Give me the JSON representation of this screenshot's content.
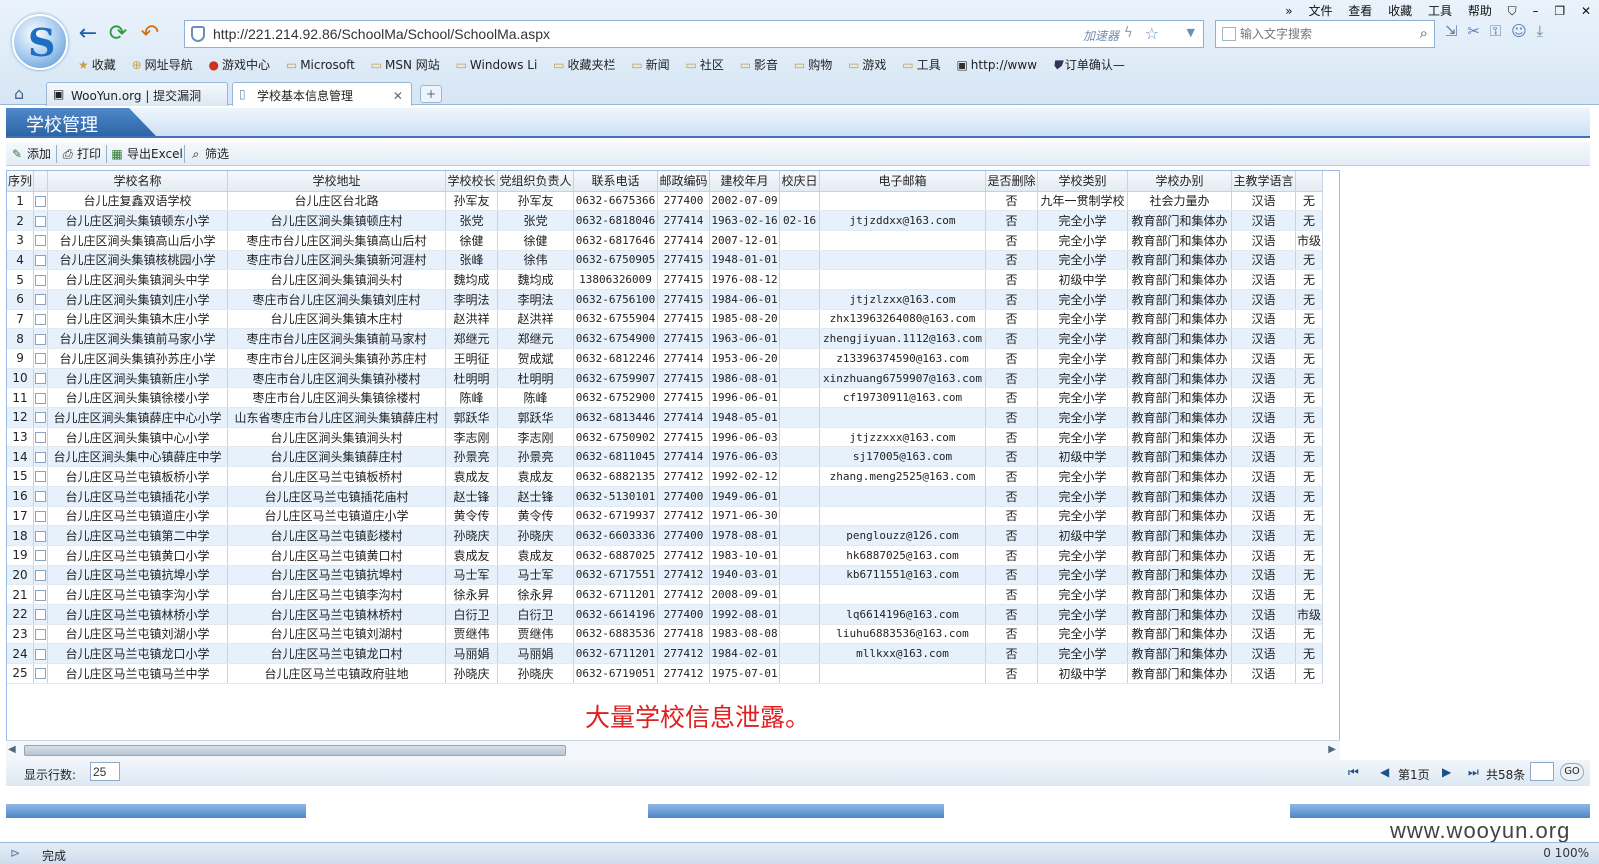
{
  "browser": {
    "menu": [
      "文件",
      "查看",
      "收藏",
      "工具",
      "帮助"
    ],
    "url": "http://221.214.92.86/SchoolMa/School/SchoolMa.aspx",
    "accelerator": "加速器",
    "search_placeholder": "输入文字搜索",
    "favorites": [
      "收藏",
      "网址导航",
      "游戏中心",
      "Microsoft",
      "MSN 网站",
      "Windows Li",
      "收藏夹栏",
      "新闻",
      "社区",
      "影音",
      "购物",
      "游戏",
      "工具",
      "http://www",
      "订单确认—"
    ],
    "tabs": [
      {
        "label": "WooYun.org | 提交漏洞"
      },
      {
        "label": "学校基本信息管理"
      }
    ],
    "status_text": "完成",
    "status_right": "0    100%"
  },
  "page": {
    "title": "学校管理",
    "toolbar": {
      "add": "添加",
      "print": "打印",
      "export": "导出Excel",
      "filter": "筛选"
    },
    "columns": [
      "序列",
      "",
      "学校名称",
      "学校地址",
      "学校校长",
      "党组织负责人",
      "联系电话",
      "邮政编码",
      "建校年月",
      "校庆日",
      "电子邮箱",
      "是否删除",
      "学校类别",
      "学校办别",
      "主教学语言",
      ""
    ],
    "rows": [
      [
        "1",
        "台儿庄复鑫双语学校",
        "台儿庄区台北路",
        "孙军友",
        "孙军友",
        "0632-6675366",
        "277400",
        "2002-07-09",
        "",
        "",
        "否",
        "九年一贯制学校",
        "社会力量办",
        "汉语",
        "无"
      ],
      [
        "2",
        "台儿庄区涧头集镇顿东小学",
        "台儿庄区涧头集镇顿庄村",
        "张党",
        "张党",
        "0632-6818046",
        "277414",
        "1963-02-16",
        "02-16",
        "jtjzddxx@163.com",
        "否",
        "完全小学",
        "教育部门和集体办",
        "汉语",
        "无"
      ],
      [
        "3",
        "台儿庄区涧头集镇高山后小学",
        "枣庄市台儿庄区涧头集镇高山后村",
        "徐健",
        "徐健",
        "0632-6817646",
        "277414",
        "2007-12-01",
        "",
        "",
        "否",
        "完全小学",
        "教育部门和集体办",
        "汉语",
        "市级"
      ],
      [
        "4",
        "台儿庄区涧头集镇核桃园小学",
        "枣庄市台儿庄区涧头集镇新河涯村",
        "张峰",
        "徐伟",
        "0632-6750905",
        "277415",
        "1948-01-01",
        "",
        "",
        "否",
        "完全小学",
        "教育部门和集体办",
        "汉语",
        "无"
      ],
      [
        "5",
        "台儿庄区涧头集镇涧头中学",
        "台儿庄区涧头集镇涧头村",
        "魏均成",
        "魏均成",
        "13806326009",
        "277415",
        "1976-08-12",
        "",
        "",
        "否",
        "初级中学",
        "教育部门和集体办",
        "汉语",
        "无"
      ],
      [
        "6",
        "台儿庄区涧头集镇刘庄小学",
        "枣庄市台儿庄区涧头集镇刘庄村",
        "李明法",
        "李明法",
        "0632-6756100",
        "277415",
        "1984-06-01",
        "",
        "jtjzlzxx@163.com",
        "否",
        "完全小学",
        "教育部门和集体办",
        "汉语",
        "无"
      ],
      [
        "7",
        "台儿庄区涧头集镇木庄小学",
        "台儿庄区涧头集镇木庄村",
        "赵洪祥",
        "赵洪祥",
        "0632-6755904",
        "277415",
        "1985-08-20",
        "",
        "zhx13963264080@163.com",
        "否",
        "完全小学",
        "教育部门和集体办",
        "汉语",
        "无"
      ],
      [
        "8",
        "台儿庄区涧头集镇前马家小学",
        "枣庄市台儿庄区涧头集镇前马家村",
        "郑继元",
        "郑继元",
        "0632-6754900",
        "277415",
        "1963-06-01",
        "",
        "zhengjiyuan.1112@163.com",
        "否",
        "完全小学",
        "教育部门和集体办",
        "汉语",
        "无"
      ],
      [
        "9",
        "台儿庄区涧头集镇孙苏庄小学",
        "枣庄市台儿庄区涧头集镇孙苏庄村",
        "王明征",
        "贺成斌",
        "0632-6812246",
        "277414",
        "1953-06-20",
        "",
        "z13396374590@163.com",
        "否",
        "完全小学",
        "教育部门和集体办",
        "汉语",
        "无"
      ],
      [
        "10",
        "台儿庄区涧头集镇新庄小学",
        "枣庄市台儿庄区涧头集镇孙楼村",
        "杜明明",
        "杜明明",
        "0632-6759907",
        "277415",
        "1986-08-01",
        "",
        "xinzhuang6759907@163.com",
        "否",
        "完全小学",
        "教育部门和集体办",
        "汉语",
        "无"
      ],
      [
        "11",
        "台儿庄区涧头集镇徐楼小学",
        "枣庄市台儿庄区涧头集镇徐楼村",
        "陈峰",
        "陈峰",
        "0632-6752900",
        "277415",
        "1996-06-01",
        "",
        "cf19730911@163.com",
        "否",
        "完全小学",
        "教育部门和集体办",
        "汉语",
        "无"
      ],
      [
        "12",
        "台儿庄区涧头集镇薛庄中心小学",
        "山东省枣庄市台儿庄区涧头集镇薛庄村",
        "郭跃华",
        "郭跃华",
        "0632-6813446",
        "277414",
        "1948-05-01",
        "",
        "",
        "否",
        "完全小学",
        "教育部门和集体办",
        "汉语",
        "无"
      ],
      [
        "13",
        "台儿庄区涧头集镇中心小学",
        "台儿庄区涧头集镇涧头村",
        "李志刚",
        "李志刚",
        "0632-6750902",
        "277415",
        "1996-06-03",
        "",
        "jtjzzxxx@163.com",
        "否",
        "完全小学",
        "教育部门和集体办",
        "汉语",
        "无"
      ],
      [
        "14",
        "台儿庄区涧头集中心镇薛庄中学",
        "台儿庄区涧头集镇薛庄村",
        "孙景亮",
        "孙景亮",
        "0632-6811045",
        "277414",
        "1976-06-03",
        "",
        "sj17005@163.com",
        "否",
        "初级中学",
        "教育部门和集体办",
        "汉语",
        "无"
      ],
      [
        "15",
        "台儿庄区马兰屯镇板桥小学",
        "台儿庄区马兰屯镇板桥村",
        "袁成友",
        "袁成友",
        "0632-6882135",
        "277412",
        "1992-02-12",
        "",
        "zhang.meng2525@163.com",
        "否",
        "完全小学",
        "教育部门和集体办",
        "汉语",
        "无"
      ],
      [
        "16",
        "台儿庄区马兰屯镇插花小学",
        "台儿庄区马兰屯镇插花庙村",
        "赵士锋",
        "赵士锋",
        "0632-5130101",
        "277400",
        "1949-06-01",
        "",
        "",
        "否",
        "完全小学",
        "教育部门和集体办",
        "汉语",
        "无"
      ],
      [
        "17",
        "台儿庄区马兰屯镇道庄小学",
        "台儿庄区马兰屯镇道庄小学",
        "黄令传",
        "黄令传",
        "0632-6719937",
        "277412",
        "1971-06-30",
        "",
        "",
        "否",
        "完全小学",
        "教育部门和集体办",
        "汉语",
        "无"
      ],
      [
        "18",
        "台儿庄区马兰屯镇第二中学",
        "台儿庄区马兰屯镇彭楼村",
        "孙晓庆",
        "孙晓庆",
        "0632-6603336",
        "277400",
        "1978-08-01",
        "",
        "penglouzz@126.com",
        "否",
        "初级中学",
        "教育部门和集体办",
        "汉语",
        "无"
      ],
      [
        "19",
        "台儿庄区马兰屯镇黄口小学",
        "台儿庄区马兰屯镇黄口村",
        "袁成友",
        "袁成友",
        "0632-6887025",
        "277412",
        "1983-10-01",
        "",
        "hk6887025@163.com",
        "否",
        "完全小学",
        "教育部门和集体办",
        "汉语",
        "无"
      ],
      [
        "20",
        "台儿庄区马兰屯镇抗埠小学",
        "台儿庄区马兰屯镇抗埠村",
        "马士军",
        "马士军",
        "0632-6717551",
        "277412",
        "1940-03-01",
        "",
        "kb6711551@163.com",
        "否",
        "完全小学",
        "教育部门和集体办",
        "汉语",
        "无"
      ],
      [
        "21",
        "台儿庄区马兰屯镇李沟小学",
        "台儿庄区马兰屯镇李沟村",
        "徐永昇",
        "徐永昇",
        "0632-6711201",
        "277412",
        "2008-09-01",
        "",
        "",
        "否",
        "完全小学",
        "教育部门和集体办",
        "汉语",
        "无"
      ],
      [
        "22",
        "台儿庄区马兰屯镇林桥小学",
        "台儿庄区马兰屯镇林桥村",
        "白衍卫",
        "白衍卫",
        "0632-6614196",
        "277400",
        "1992-08-01",
        "",
        "lq6614196@163.com",
        "否",
        "完全小学",
        "教育部门和集体办",
        "汉语",
        "市级"
      ],
      [
        "23",
        "台儿庄区马兰屯镇刘湖小学",
        "台儿庄区马兰屯镇刘湖村",
        "贾继伟",
        "贾继伟",
        "0632-6883536",
        "277418",
        "1983-08-08",
        "",
        "liuhu6883536@163.com",
        "否",
        "完全小学",
        "教育部门和集体办",
        "汉语",
        "无"
      ],
      [
        "24",
        "台儿庄区马兰屯镇龙口小学",
        "台儿庄区马兰屯镇龙口村",
        "马丽娟",
        "马丽娟",
        "0632-6711201",
        "277412",
        "1984-02-01",
        "",
        "mllkxx@163.com",
        "否",
        "完全小学",
        "教育部门和集体办",
        "汉语",
        "无"
      ],
      [
        "25",
        "台儿庄区马兰屯镇马兰中学",
        "台儿庄区马兰屯镇政府驻地",
        "孙晓庆",
        "孙晓庆",
        "0632-6719051",
        "277412",
        "1975-07-01",
        "",
        "",
        "否",
        "初级中学",
        "教育部门和集体办",
        "汉语",
        "无"
      ]
    ],
    "annotation": "大量学校信息泄露。",
    "pager": {
      "rows_label": "显示行数:",
      "rows_value": "25",
      "page_label": "第1页",
      "total_label": "共58条",
      "go_label": "GO"
    }
  },
  "watermark": "www.wooyun.org"
}
